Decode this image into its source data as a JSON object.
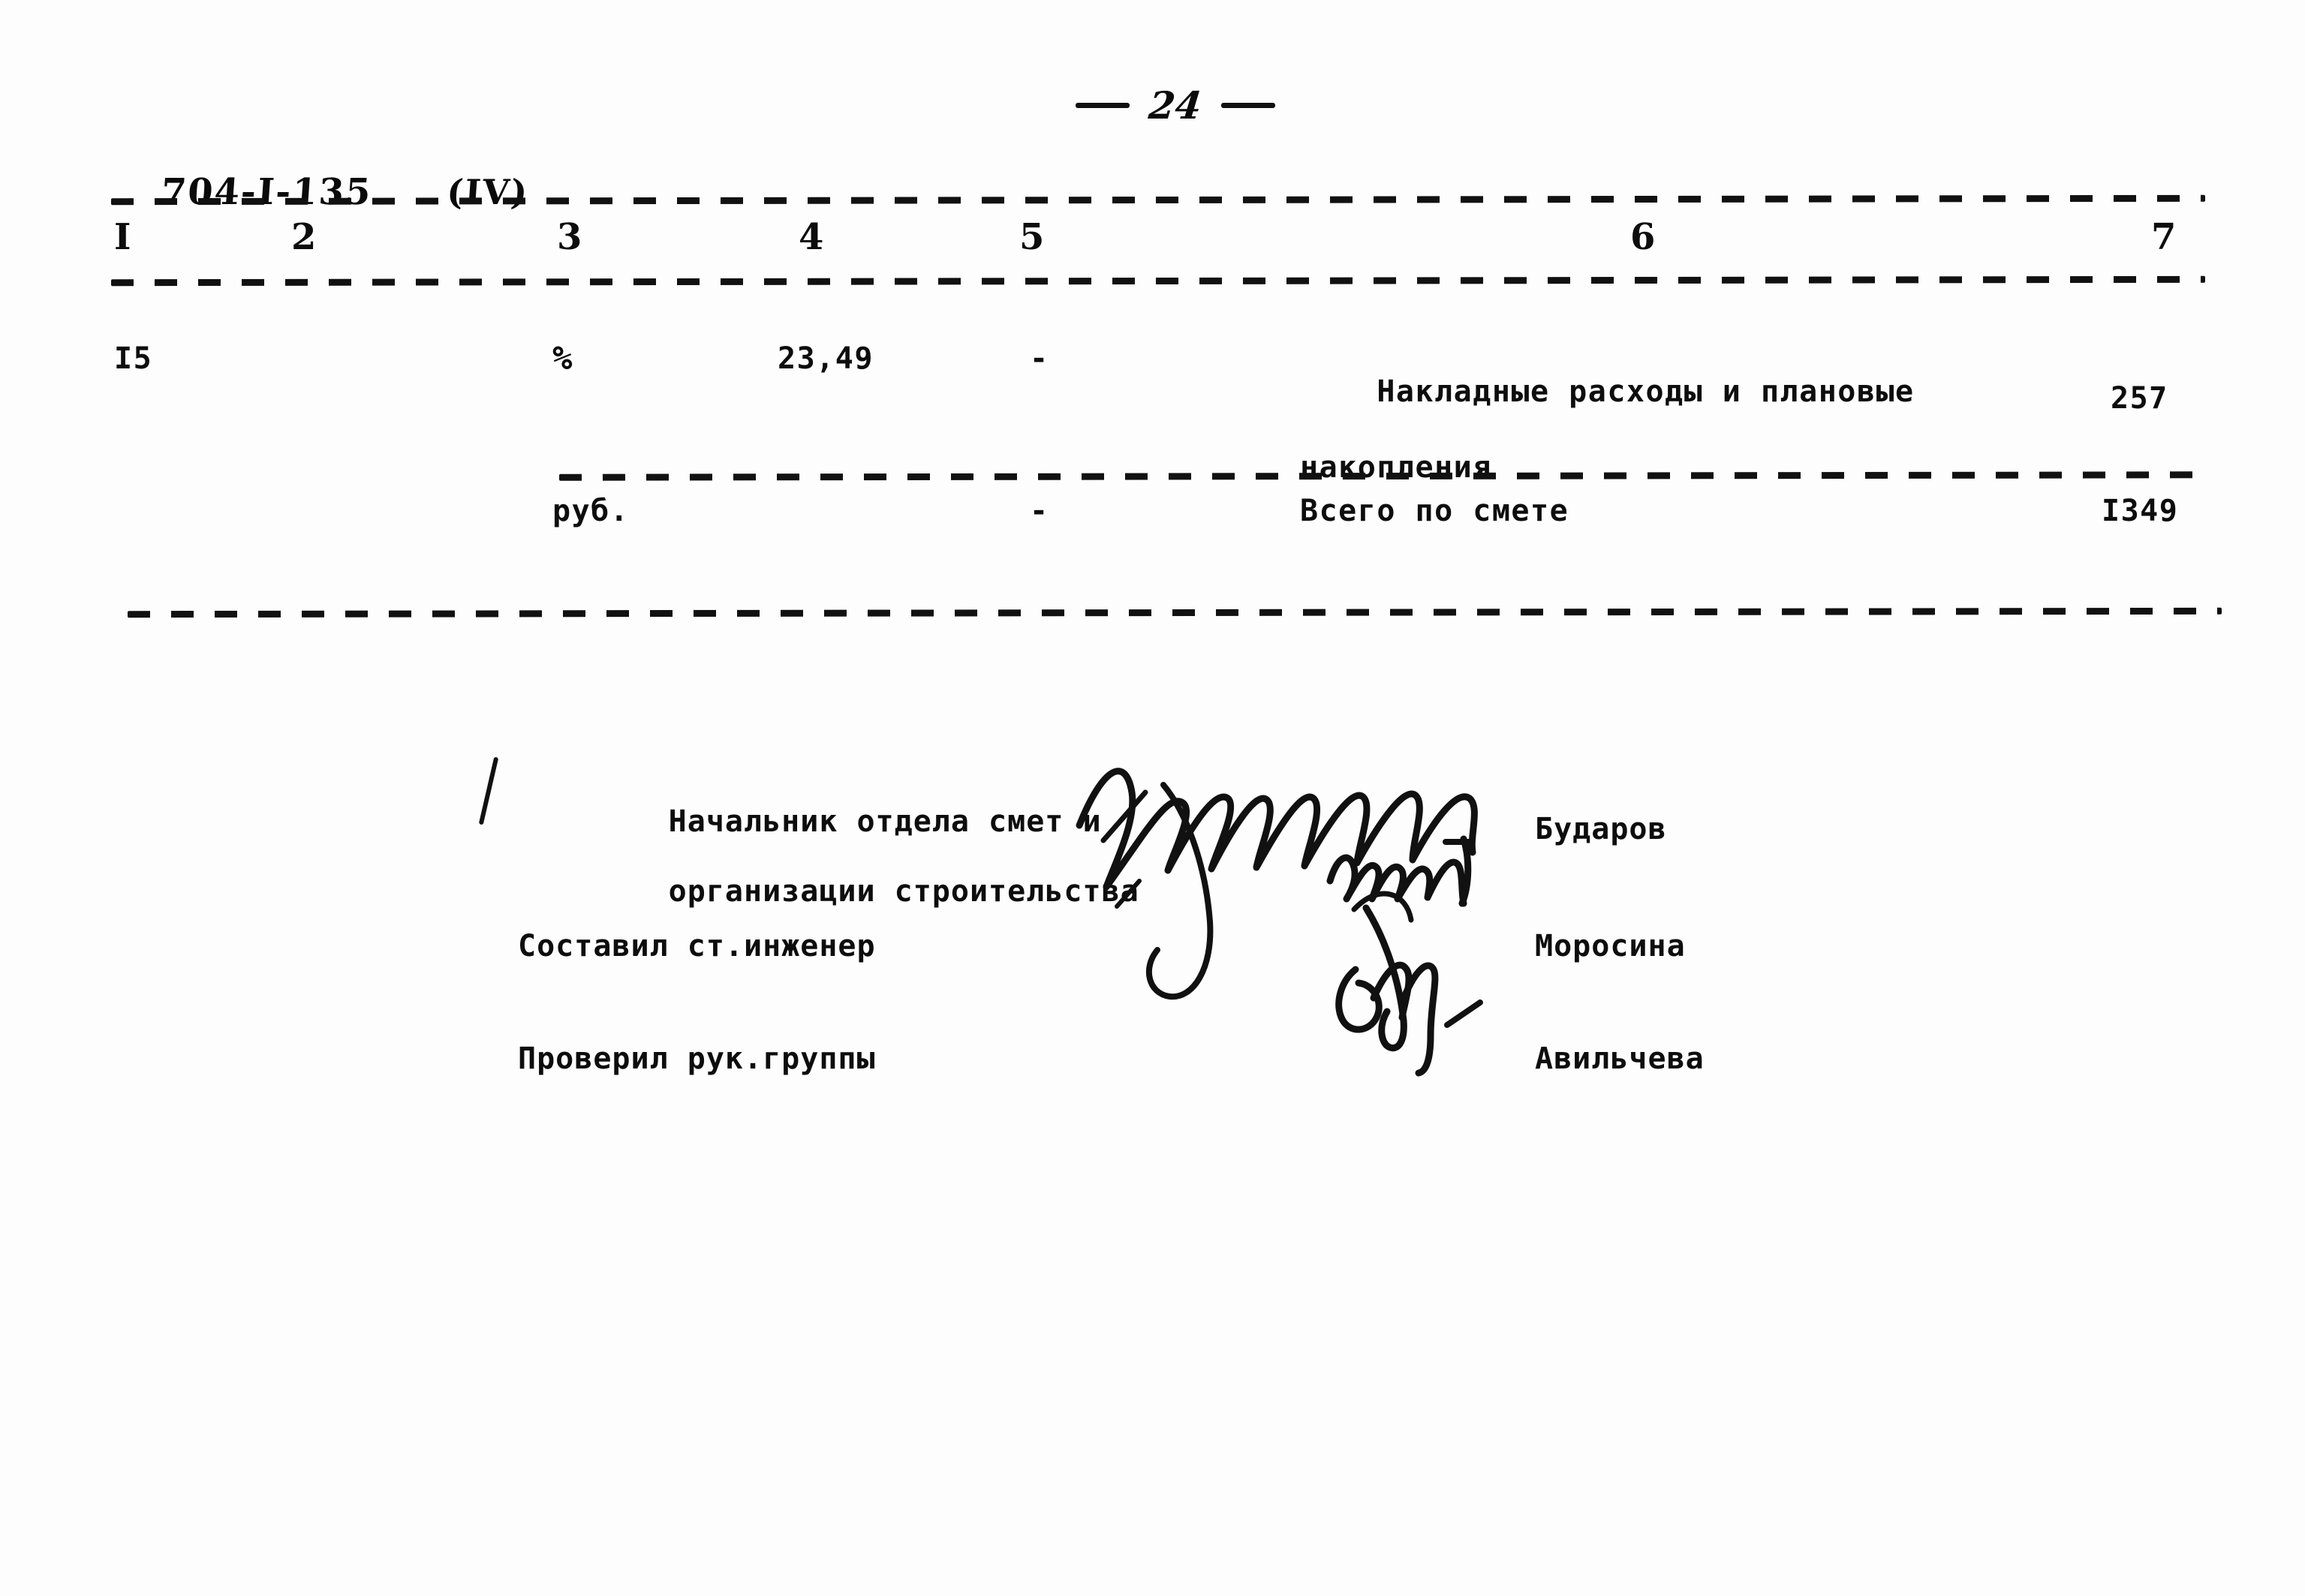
{
  "document": {
    "page_number": "24",
    "code": "704-I-135",
    "revision": "(IV)"
  },
  "table": {
    "column_headers": [
      "I",
      "2",
      "3",
      "4",
      "5",
      "6",
      "7"
    ],
    "rows": [
      {
        "no": "I5",
        "col2": "",
        "unit": "%",
        "quantity": "23,49",
        "col5": "-",
        "description_line1": "Накладные расходы и плановые",
        "description_line2": "накопления",
        "total": "257"
      },
      {
        "no": "",
        "col2": "",
        "unit": "руб.",
        "quantity": "",
        "col5": "-",
        "description_line1": "Всего по смете",
        "description_line2": "",
        "total": "I349"
      }
    ]
  },
  "signatures": [
    {
      "role_line1": "Начальник отдела смет и",
      "role_line2": "организации строительства",
      "name": "Бударов",
      "signature_icon": "handwritten-signature-icon"
    },
    {
      "role_line1": "Составил ст.инженер",
      "role_line2": "",
      "name": "Моросина",
      "signature_icon": "handwritten-signature-icon"
    },
    {
      "role_line1": "Проверил рук.группы",
      "role_line2": "",
      "name": "Авильчева",
      "signature_icon": "handwritten-signature-icon"
    }
  ],
  "colors": {
    "ink": "#0d0d0d",
    "paper": "#fdfdfd"
  }
}
